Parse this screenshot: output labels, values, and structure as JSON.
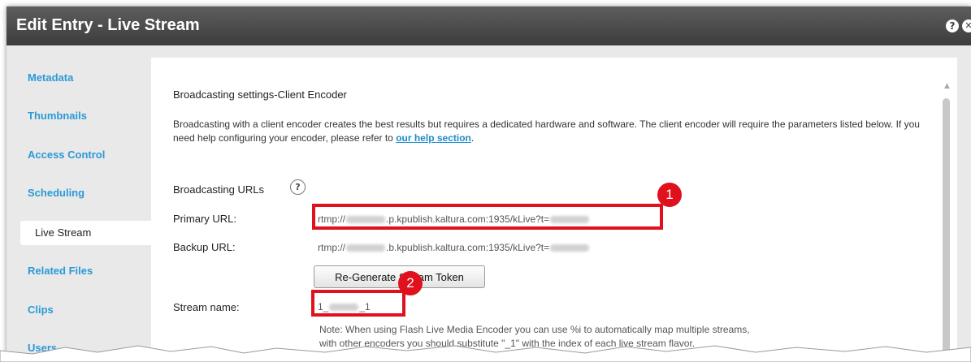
{
  "window": {
    "title": "Edit Entry - Live Stream"
  },
  "titlebar_icons": {
    "help": "?",
    "close": "✕"
  },
  "sidebar": {
    "items": [
      {
        "label": "Metadata"
      },
      {
        "label": "Thumbnails"
      },
      {
        "label": "Access Control"
      },
      {
        "label": "Scheduling"
      },
      {
        "label": "Live Stream",
        "active": true
      },
      {
        "label": "Related Files"
      },
      {
        "label": "Clips"
      },
      {
        "label": "Users"
      }
    ]
  },
  "main": {
    "section_title": "Broadcasting settings-Client Encoder",
    "description": "Broadcasting with a client encoder creates the best results but requires a dedicated hardware and software. The client encoder will require the parameters listed below. If you need help configuring your encoder, please refer to ",
    "help_link": "our help section",
    "description_end": ".",
    "urls_label": "Broadcasting URLs",
    "urls_help_icon": "?",
    "primary": {
      "label": "Primary URL:",
      "prefix": "rtmp://",
      "middle": ".p.kpublish.kaltura.com:1935/kLive?t="
    },
    "backup": {
      "label": "Backup URL:",
      "prefix": "rtmp://",
      "middle": ".b.kpublish.kaltura.com:1935/kLive?t="
    },
    "regen_button": "Re-Generate Stream Token",
    "stream": {
      "label": "Stream name:",
      "prefix": "1_",
      "suffix": "_1"
    },
    "note_line1": "Note: When using Flash Live Media Encoder you can use %i to automatically map multiple streams,",
    "note_line2": "with other encoders you should substitute \"_1\" with the index of each live stream flavor."
  },
  "annotations": {
    "badge1": "1",
    "badge2": "2",
    "color": "#e0101c"
  },
  "colors": {
    "titlebar": "#4a4a4a",
    "nav_link": "#2a9ad6",
    "link": "#1e8bc8"
  }
}
